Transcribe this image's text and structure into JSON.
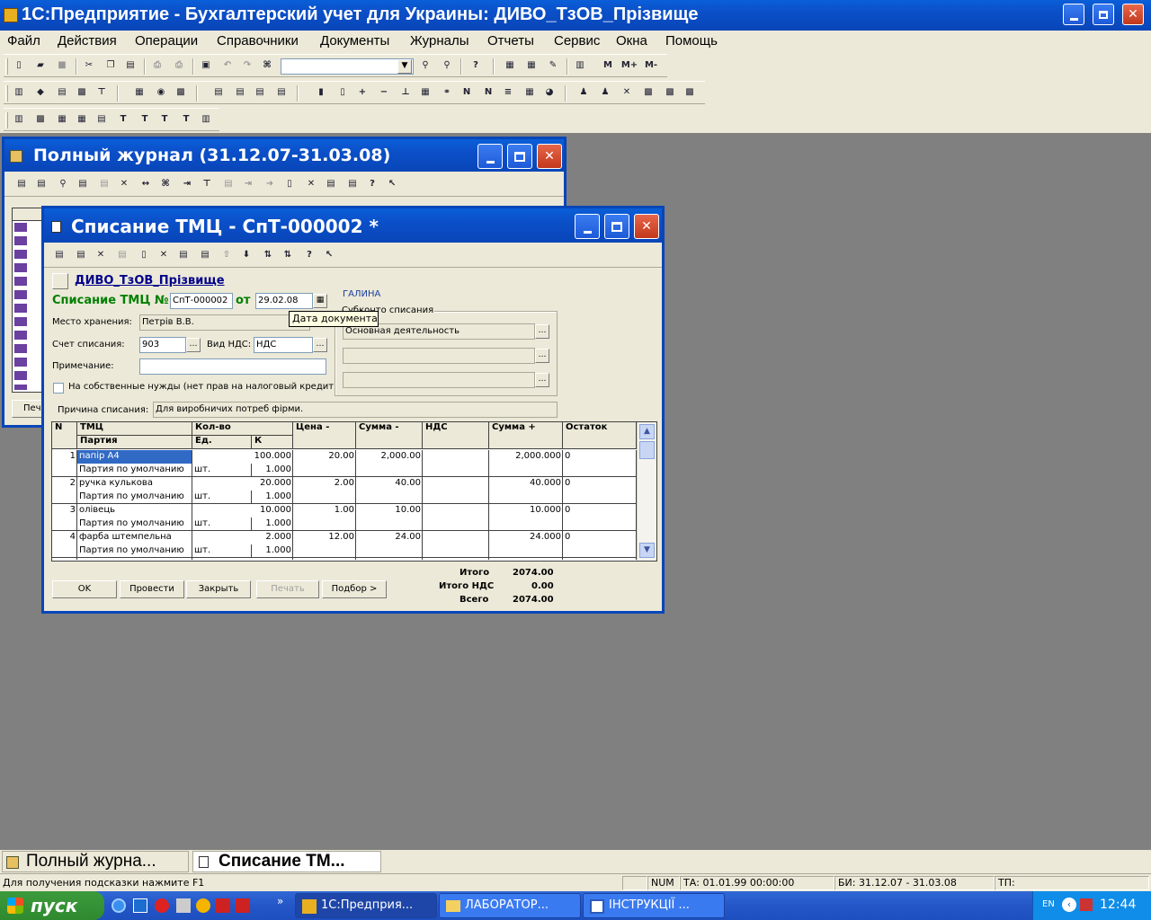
{
  "app": {
    "title": "1С:Предприятие - Бухгалтерский учет для Украины: ДИВО_ТзОВ_Прізвище"
  },
  "menu": [
    "Файл",
    "Действия",
    "Операции",
    "Справочники",
    "Документы",
    "Журналы",
    "Отчеты",
    "Сервис",
    "Окна",
    "Помощь"
  ],
  "toolbar": {
    "m_buttons": [
      "M",
      "M+",
      "M-"
    ]
  },
  "journal_window": {
    "title": "Полный журнал (31.12.07-31.03.08)",
    "print_button": "Печа"
  },
  "doc_window": {
    "title": "Списание ТМЦ - СпТ-000002 *",
    "company_link": "ДИВО_ТзОВ_Прізвище",
    "doc_type_label": "Списание ТМЦ №",
    "doc_number": "СпТ-000002",
    "date_label": "от",
    "doc_date": "29.02.08",
    "tooltip": "Дата документа",
    "user": "ГАЛИНА",
    "storage_label": "Место хранения:",
    "storage_value": "Петрів В.В.",
    "account_label": "Счет списания:",
    "account_value": "903",
    "vat_type_label": "Вид НДС:",
    "vat_type_value": "НДС",
    "note_label": "Примечание:",
    "note_value": "",
    "own_needs_label": "На собственные нужды (нет прав на налоговый кредит)",
    "subconto_label": "Субконто списания",
    "subconto_values": [
      "Основная деятельность",
      "",
      ""
    ],
    "reason_label": "Причина списания:",
    "reason_value": "Для виробничих потреб фірми.",
    "table": {
      "headers": {
        "n": "N",
        "tmc": "ТМЦ",
        "party": "Партия",
        "qty": "Кол-во",
        "unit": "Ед.",
        "k": "К",
        "price": "Цена -",
        "sum_minus": "Сумма -",
        "vat": "НДС",
        "sum_plus": "Сумма +",
        "rest": "Остаток"
      },
      "rows": [
        {
          "n": "1",
          "tmc": "папір А4",
          "party": "Партия по умолчанию",
          "qty": "100.000",
          "unit": "шт.",
          "k": "1.000",
          "price": "20.00",
          "sum_minus": "2,000.00",
          "vat": "",
          "sum_plus": "2,000.000",
          "rest": "0"
        },
        {
          "n": "2",
          "tmc": "ручка кулькова",
          "party": "Партия по умолчанию",
          "qty": "20.000",
          "unit": "шт.",
          "k": "1.000",
          "price": "2.00",
          "sum_minus": "40.00",
          "vat": "",
          "sum_plus": "40.000",
          "rest": "0"
        },
        {
          "n": "3",
          "tmc": "олівець",
          "party": "Партия по умолчанию",
          "qty": "10.000",
          "unit": "шт.",
          "k": "1.000",
          "price": "1.00",
          "sum_minus": "10.00",
          "vat": "",
          "sum_plus": "10.000",
          "rest": "0"
        },
        {
          "n": "4",
          "tmc": "фарба штемпельна",
          "party": "Партия по умолчанию",
          "qty": "2.000",
          "unit": "шт.",
          "k": "1.000",
          "price": "12.00",
          "sum_minus": "24.00",
          "vat": "",
          "sum_plus": "24.000",
          "rest": "0"
        }
      ]
    },
    "totals": {
      "total_label": "Итого",
      "total_value": "2074.00",
      "vat_label": "Итого НДС",
      "vat_value": "0.00",
      "all_label": "Всего",
      "all_value": "2074.00"
    },
    "buttons": {
      "ok": "OK",
      "post": "Провести",
      "close": "Закрыть",
      "print": "Печать",
      "select": "Подбор >"
    }
  },
  "mdi_tabs": [
    "Полный журна...",
    "Списание ТМ..."
  ],
  "status": {
    "hint": "Для получения подсказки нажмите F1",
    "num": "NUM",
    "ta": "ТА: 01.01.99  00:00:00",
    "bi": "БИ: 31.12.07 - 31.03.08",
    "tp": "ТП:"
  },
  "taskbar": {
    "start": "пуск",
    "tasks": [
      "1С:Предприя...",
      "ЛАБОРАТОР...",
      "ІНСТРУКЦІЇ ..."
    ],
    "lang": "EN",
    "time": "12:44"
  }
}
